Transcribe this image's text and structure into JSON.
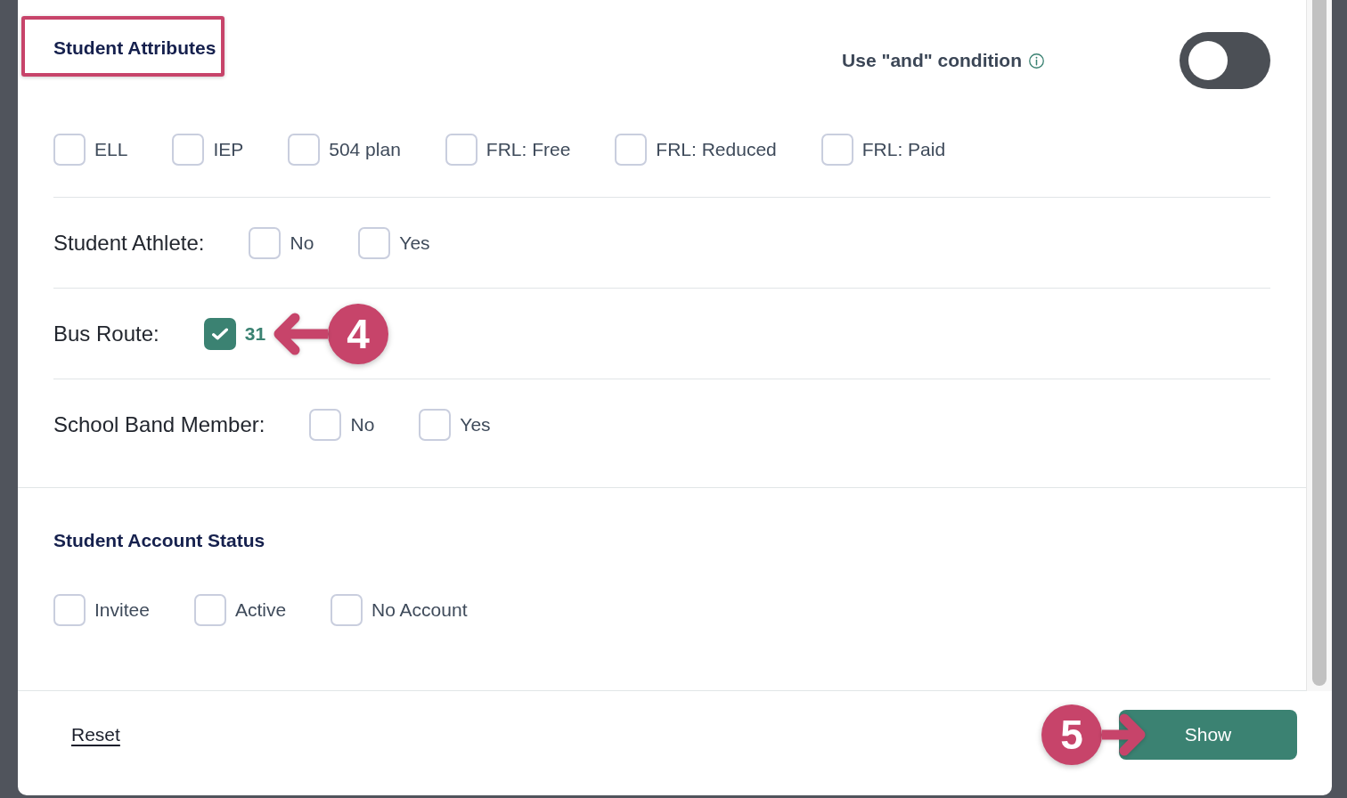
{
  "student_attributes": {
    "title": "Student Attributes",
    "title_highlighted": true,
    "and_condition": {
      "label": "Use \"and\" condition",
      "on": false
    },
    "options": [
      {
        "label": "ELL",
        "checked": false
      },
      {
        "label": "IEP",
        "checked": false
      },
      {
        "label": "504 plan",
        "checked": false
      },
      {
        "label": "FRL: Free",
        "checked": false
      },
      {
        "label": "FRL: Reduced",
        "checked": false
      },
      {
        "label": "FRL: Paid",
        "checked": false
      }
    ],
    "rows": [
      {
        "label": "Student Athlete:",
        "options": [
          {
            "label": "No",
            "checked": false
          },
          {
            "label": "Yes",
            "checked": false
          }
        ]
      },
      {
        "label": "Bus Route:",
        "options": [
          {
            "label": "31",
            "checked": true,
            "callout": "4"
          }
        ]
      },
      {
        "label": "School Band Member:",
        "options": [
          {
            "label": "No",
            "checked": false
          },
          {
            "label": "Yes",
            "checked": false
          }
        ]
      }
    ]
  },
  "student_account_status": {
    "title": "Student Account Status",
    "options": [
      {
        "label": "Invitee",
        "checked": false
      },
      {
        "label": "Active",
        "checked": false
      },
      {
        "label": "No Account",
        "checked": false
      }
    ]
  },
  "footer": {
    "reset": "Reset",
    "show": {
      "label": "Show",
      "callout": "5"
    }
  }
}
